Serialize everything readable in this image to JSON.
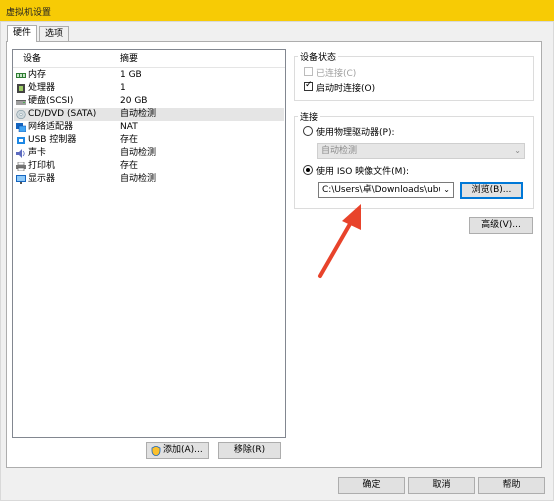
{
  "window": {
    "title": "虚拟机设置"
  },
  "tabs": [
    {
      "label": "硬件"
    },
    {
      "label": "选项"
    }
  ],
  "device_list": {
    "headers": {
      "device": "设备",
      "summary": "摘要"
    },
    "items": [
      {
        "name": "内存",
        "summary": "1 GB",
        "icon": "memory-icon"
      },
      {
        "name": "处理器",
        "summary": "1",
        "icon": "processor-icon"
      },
      {
        "name": "硬盘(SCSI)",
        "summary": "20 GB",
        "icon": "hard-disk-icon"
      },
      {
        "name": "CD/DVD (SATA)",
        "summary": "自动检测",
        "icon": "cd-dvd-icon",
        "selected": true
      },
      {
        "name": "网络适配器",
        "summary": "NAT",
        "icon": "network-adapter-icon"
      },
      {
        "name": "USB 控制器",
        "summary": "存在",
        "icon": "usb-controller-icon"
      },
      {
        "name": "声卡",
        "summary": "自动检测",
        "icon": "sound-card-icon"
      },
      {
        "name": "打印机",
        "summary": "存在",
        "icon": "printer-icon"
      },
      {
        "name": "显示器",
        "summary": "自动检测",
        "icon": "display-icon"
      }
    ]
  },
  "list_buttons": {
    "add": "添加(A)...",
    "remove": "移除(R)"
  },
  "device_status": {
    "title": "设备状态",
    "connected": {
      "label": "已连接(C)",
      "checked": false,
      "enabled": false
    },
    "connect_at_power_on": {
      "label": "启动时连接(O)",
      "checked": true
    }
  },
  "connection": {
    "title": "连接",
    "physical_drive": {
      "label": "使用物理驱动器(P):",
      "selected": false
    },
    "physical_drive_select": {
      "value": "自动检测",
      "enabled": false
    },
    "iso_image": {
      "label": "使用 ISO 映像文件(M):",
      "selected": true
    },
    "iso_path": {
      "value": "C:\\Users\\卓\\Downloads\\ubu"
    },
    "browse_button": "浏览(B)..."
  },
  "advanced_button": "高级(V)...",
  "footer": {
    "ok": "确定",
    "cancel": "取消",
    "help": "帮助"
  },
  "colors": {
    "title_bar": "#f7cb05",
    "annotation_arrow": "#e8432b",
    "focus": "#0078d7"
  }
}
